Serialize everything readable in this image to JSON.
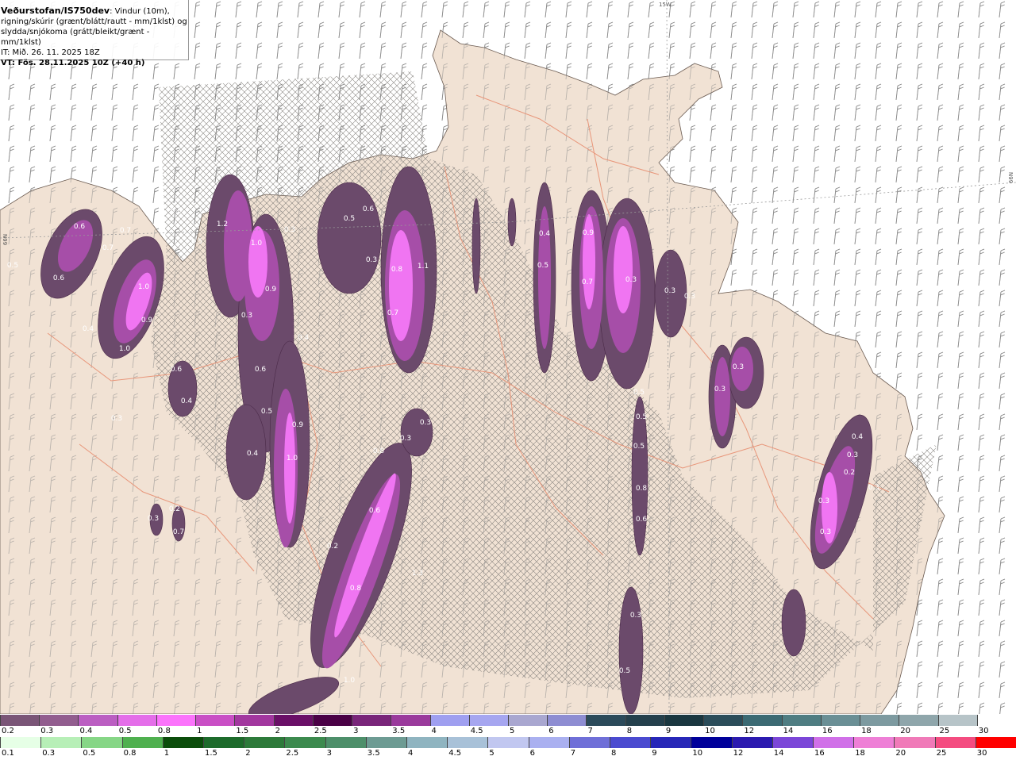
{
  "header": {
    "model": "Veðurstofan/IS750dev",
    "variables": ": Vindur (10m),",
    "line2": "rigning/skúrir (grænt/blátt/rautt - mm/1klst) og",
    "line3": "slydda/snjókoma (grátt/bleikt/grænt - mm/1klst)",
    "issue_time": "IT: Mið. 26. 11. 2025 18Z",
    "valid_time": "VT: Fös. 28.11.2025 10Z (+40 h)"
  },
  "grid_labels": {
    "top": "15W",
    "right": "66N",
    "left": "66N"
  },
  "contour_values": [
    "0.6",
    "0.7",
    "0.5",
    "0.7",
    "0.6",
    "1.0",
    "0.4",
    "0.9",
    "1.0",
    "0.6",
    "0.4",
    "0.3",
    "0.6",
    "0.5",
    "1.2",
    "1.0",
    "0.9",
    "0.3",
    "0.3",
    "0.4",
    "0.6",
    "0.5",
    "0.4",
    "0.9",
    "1.0",
    "0.5",
    "0.6",
    "0.3",
    "0.8",
    "1.1",
    "0.7",
    "0.3",
    "0.3",
    "0.8",
    "0.6",
    "0.2",
    "0.2",
    "0.3",
    "0.7",
    "0.8",
    "1.0",
    "1.3",
    "0.4",
    "0.5",
    "0.9",
    "0.7",
    "0.3",
    "0.3",
    "0.3",
    "0.3",
    "0.3",
    "0.5",
    "0.5",
    "0.5",
    "0.8",
    "0.6",
    "0.3",
    "0.5",
    "0.4",
    "0.3",
    "0.2",
    "0.3",
    "0.3",
    "0.3"
  ],
  "legend_snow": {
    "labels": [
      "0.2",
      "0.3",
      "0.4",
      "0.5",
      "0.8",
      "1",
      "1.5",
      "2",
      "2.5",
      "3",
      "3.5",
      "4",
      "4.5",
      "5",
      "6",
      "7",
      "8",
      "9",
      "10",
      "12",
      "14",
      "16",
      "18",
      "20",
      "25",
      "30"
    ],
    "colors": [
      "#7a5577",
      "#925d8f",
      "#bb5ec2",
      "#e46ee9",
      "#fb73fb",
      "#c94fc5",
      "#a2379f",
      "#6a0f67",
      "#4a0046",
      "#79257a",
      "#9a3a9c",
      "#9f9ff0",
      "#a6a6f0",
      "#a9a7d0",
      "#8e8dd2",
      "#2b4a5a",
      "#24404c",
      "#1a3740",
      "#2b4d5a",
      "#3b6a73",
      "#4f7d82",
      "#6a8f95",
      "#7d9aa0",
      "#8fa6ab",
      "#b7c4c8",
      "#ffffff"
    ]
  },
  "legend_rain": {
    "labels": [
      "0.1",
      "0.3",
      "0.5",
      "0.8",
      "1",
      "1.5",
      "2",
      "2.5",
      "3",
      "3.5",
      "4",
      "4.5",
      "5",
      "6",
      "7",
      "8",
      "9",
      "10",
      "12",
      "14",
      "16",
      "18",
      "20",
      "25",
      "30"
    ],
    "colors": [
      "#e6ffe6",
      "#b7efb7",
      "#86d686",
      "#4fb04f",
      "#0b4d0b",
      "#1d6b2b",
      "#2d7a3a",
      "#3c8a4e",
      "#4d8f6a",
      "#6d9b93",
      "#8fb4c0",
      "#a8c1d8",
      "#c1c7f0",
      "#aab0f0",
      "#6f6fd8",
      "#4a4ad0",
      "#2727b8",
      "#00009a",
      "#2b1ab0",
      "#7b46d8",
      "#d070e8",
      "#ee7fd6",
      "#f07ab8",
      "#f44c80",
      "#ff0000"
    ]
  }
}
